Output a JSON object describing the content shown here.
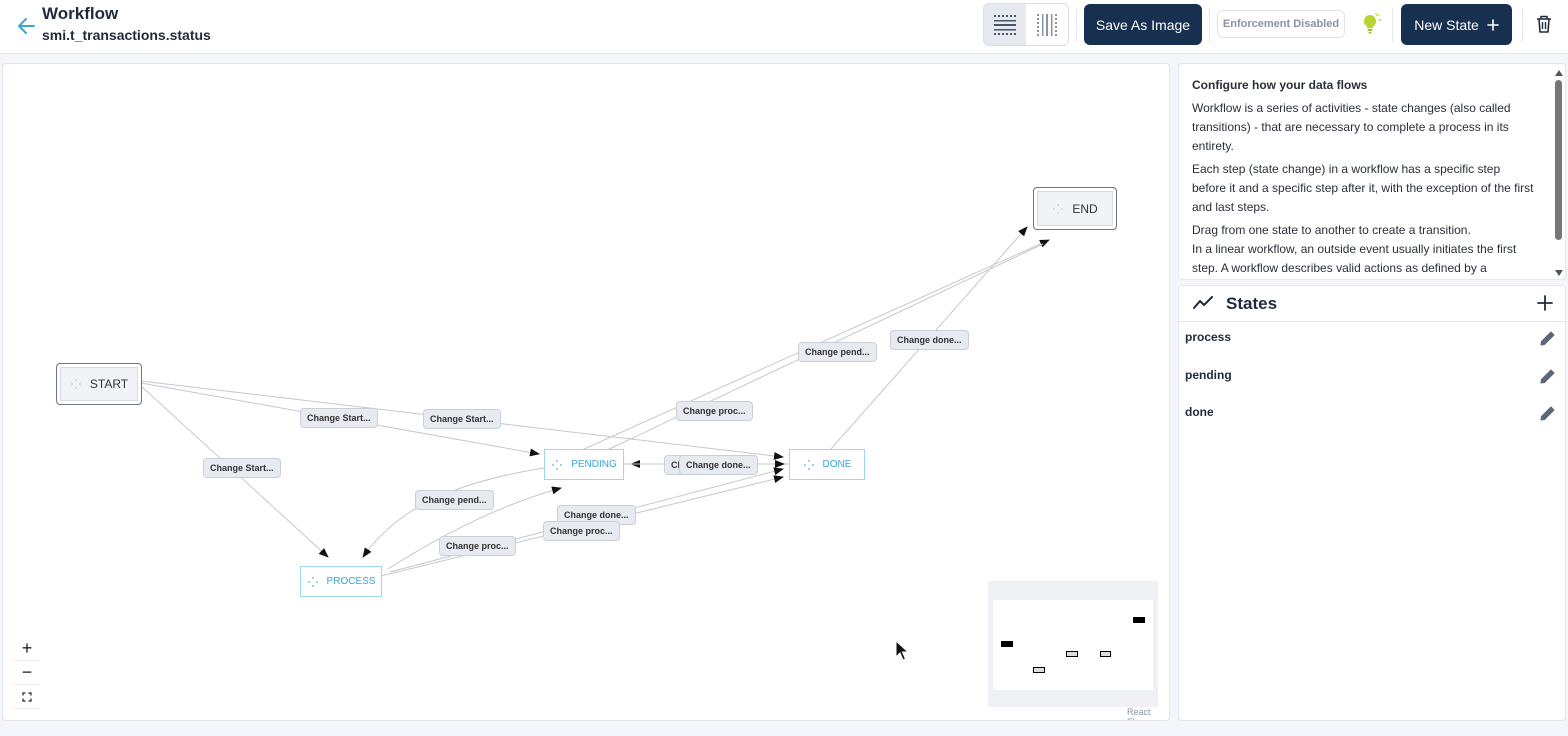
{
  "header": {
    "title": "Workflow",
    "subtitle": "smi.t_transactions.status",
    "save_image_label": "Save As Image",
    "enforcement_label": "Enforcement Disabled",
    "new_state_label": "New State",
    "icons": [
      "back-arrow-icon",
      "horizontal-layout-icon",
      "vertical-layout-icon",
      "lightbulb-icon",
      "plus-icon",
      "trash-icon"
    ],
    "accent_color": "#17304f",
    "bulb_color": "#b7d433"
  },
  "canvas": {
    "nodes": {
      "start": "START",
      "end": "END",
      "pending": "PENDING",
      "done": "DONE",
      "process": "PROCESS"
    },
    "edge_labels": [
      "Change Start...",
      "Change Start...",
      "Change Start...",
      "Change pend...",
      "Change proc...",
      "Change done...",
      "Change pend...",
      "Change proc...",
      "Change done...",
      "Change proc...",
      "Change done...",
      "Change pend..."
    ],
    "state_color": "#3aa3d8",
    "zoom_in": "+",
    "zoom_out": "−",
    "fit_view": "⛶",
    "attribution": "React Flow"
  },
  "info": {
    "heading": "Configure how your data flows",
    "paragraphs": [
      "Workflow is a series of activities - state changes (also called transitions) - that are necessary to complete a process in its entirety.",
      "Each step (state change) in a workflow has a specific step before it and a specific step after it, with the exception of the first and last steps.",
      "Drag from one state to another to create a transition.",
      "In a linear workflow, an outside event usually initiates the first step. A workflow describes valid actions as defined by a"
    ]
  },
  "states": {
    "title": "States",
    "items": [
      "process",
      "pending",
      "done"
    ]
  }
}
